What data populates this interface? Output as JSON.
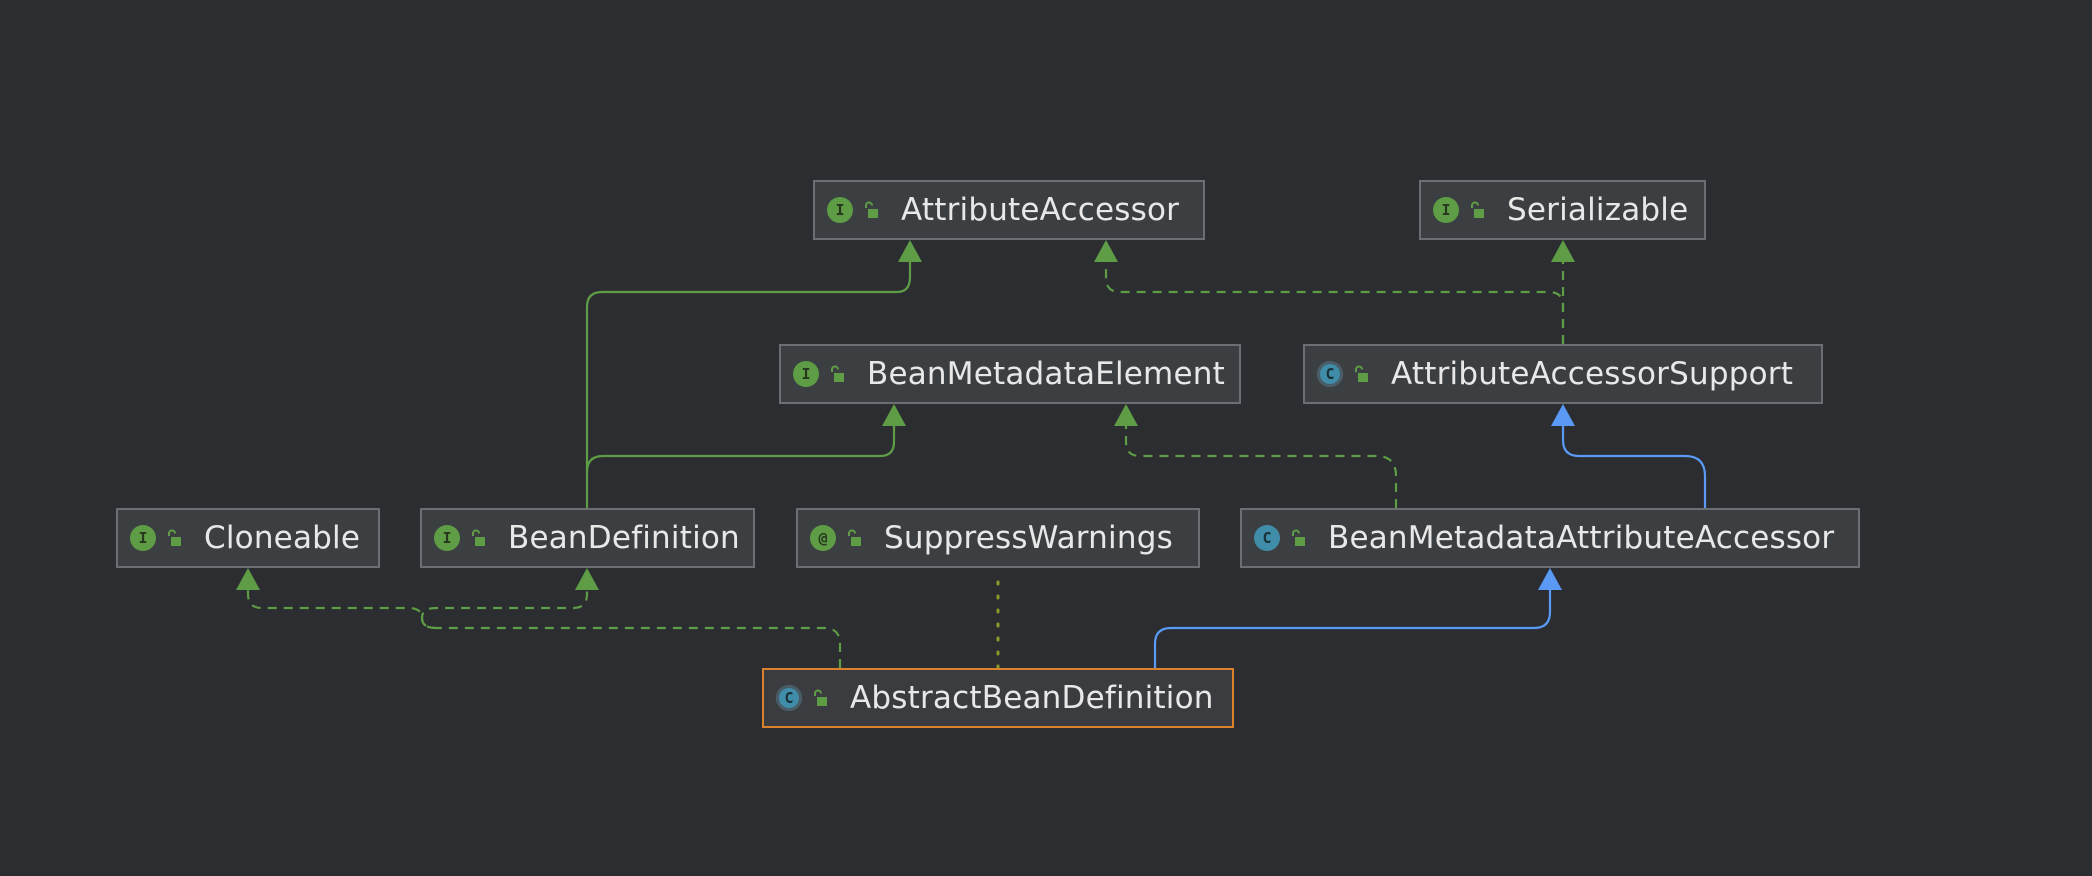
{
  "diagram": {
    "colors": {
      "background": "#2b2d31",
      "interface_edge": "#5e9d45",
      "class_edge": "#5a9af5",
      "annotation_edge": "#8c9a2a",
      "selected_border": "#d9822b"
    },
    "nodes": [
      {
        "id": "attribute-accessor",
        "label": "AttributeAccessor",
        "kind": "interface",
        "kind_glyph": "I",
        "visibility_icon": "public-lock-icon"
      },
      {
        "id": "serializable",
        "label": "Serializable",
        "kind": "interface",
        "kind_glyph": "I",
        "visibility_icon": "public-lock-icon"
      },
      {
        "id": "bean-metadata-element",
        "label": "BeanMetadataElement",
        "kind": "interface",
        "kind_glyph": "I",
        "visibility_icon": "public-lock-icon"
      },
      {
        "id": "attribute-accessor-support",
        "label": "AttributeAccessorSupport",
        "kind": "abstract-class",
        "kind_glyph": "C",
        "visibility_icon": "public-lock-icon"
      },
      {
        "id": "cloneable",
        "label": "Cloneable",
        "kind": "interface",
        "kind_glyph": "I",
        "visibility_icon": "public-lock-icon"
      },
      {
        "id": "bean-definition",
        "label": "BeanDefinition",
        "kind": "interface",
        "kind_glyph": "I",
        "visibility_icon": "public-lock-icon"
      },
      {
        "id": "suppress-warnings",
        "label": "SuppressWarnings",
        "kind": "annotation",
        "kind_glyph": "@",
        "visibility_icon": "public-lock-icon"
      },
      {
        "id": "bean-metadata-attribute-accessor",
        "label": "BeanMetadataAttributeAccessor",
        "kind": "class",
        "kind_glyph": "C",
        "visibility_icon": "public-lock-icon"
      },
      {
        "id": "abstract-bean-definition",
        "label": "AbstractBeanDefinition",
        "kind": "abstract-class",
        "kind_glyph": "C",
        "visibility_icon": "public-lock-icon",
        "selected": true
      }
    ],
    "edges": [
      {
        "from": "bean-definition",
        "to": "attribute-accessor",
        "type": "extends-interface"
      },
      {
        "from": "bean-definition",
        "to": "bean-metadata-element",
        "type": "extends-interface"
      },
      {
        "from": "attribute-accessor-support",
        "to": "attribute-accessor",
        "type": "implements"
      },
      {
        "from": "attribute-accessor-support",
        "to": "serializable",
        "type": "implements"
      },
      {
        "from": "bean-metadata-attribute-accessor",
        "to": "bean-metadata-element",
        "type": "implements"
      },
      {
        "from": "bean-metadata-attribute-accessor",
        "to": "attribute-accessor-support",
        "type": "extends"
      },
      {
        "from": "abstract-bean-definition",
        "to": "cloneable",
        "type": "implements"
      },
      {
        "from": "abstract-bean-definition",
        "to": "bean-definition",
        "type": "implements"
      },
      {
        "from": "abstract-bean-definition",
        "to": "suppress-warnings",
        "type": "annotated-with"
      },
      {
        "from": "abstract-bean-definition",
        "to": "bean-metadata-attribute-accessor",
        "type": "extends"
      }
    ]
  }
}
